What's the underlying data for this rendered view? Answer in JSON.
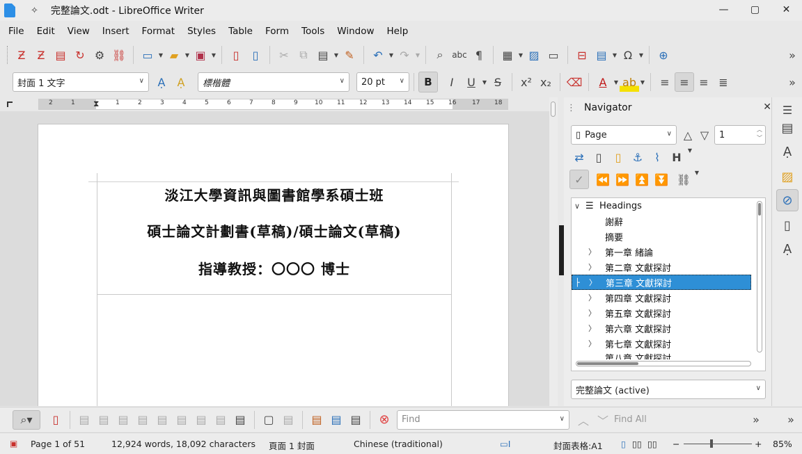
{
  "window": {
    "title": "完整論文.odt - LibreOffice Writer",
    "pin_icon": "pin-icon",
    "minimize": "—",
    "maximize": "▢",
    "close": "✕"
  },
  "menu": [
    "File",
    "Edit",
    "View",
    "Insert",
    "Format",
    "Styles",
    "Table",
    "Form",
    "Tools",
    "Window",
    "Help"
  ],
  "formatting": {
    "paragraph_style": "封面 1 文字",
    "font_name": "標楷體",
    "font_size": "20 pt"
  },
  "ruler": {
    "labels": [
      "2",
      "1",
      "1",
      "2",
      "3",
      "4",
      "5",
      "6",
      "7",
      "8",
      "9",
      "10",
      "11",
      "12",
      "13",
      "14",
      "15",
      "16",
      "17",
      "18"
    ]
  },
  "document": {
    "line1": "淡江大學資訊與圖書館學系碩士班",
    "line2": "碩士論文計劃書(草稿)/碩士論文(草稿)",
    "line3": "指導教授：〇〇〇  博士"
  },
  "navigator": {
    "title": "Navigator",
    "navigate_by": "Page",
    "page_number": "1",
    "headings_label": "Headings",
    "headings": [
      {
        "label": "謝辭",
        "expandable": false,
        "selected": false
      },
      {
        "label": "摘要",
        "expandable": false,
        "selected": false
      },
      {
        "label": "第一章 緒論",
        "expandable": true,
        "selected": false
      },
      {
        "label": "第二章 文獻探討",
        "expandable": true,
        "selected": false
      },
      {
        "label": "第三章 文獻探討",
        "expandable": true,
        "selected": true
      },
      {
        "label": "第四章 文獻探討",
        "expandable": true,
        "selected": false
      },
      {
        "label": "第五章 文獻探討",
        "expandable": true,
        "selected": false
      },
      {
        "label": "第六章 文獻探討",
        "expandable": true,
        "selected": false
      },
      {
        "label": "第七章 文獻探討",
        "expandable": true,
        "selected": false
      },
      {
        "label": "第八章 文獻探討",
        "expandable": true,
        "selected": false
      }
    ],
    "document_select": "完整論文 (active)"
  },
  "find": {
    "placeholder": "Find",
    "find_all": "Find All"
  },
  "status": {
    "page": "Page 1 of 51",
    "words": "12,924 words, 18,092 characters",
    "page_style": "頁面 1 封面",
    "language": "Chinese (traditional)",
    "table_cell": "封面表格:A1",
    "zoom": "85%"
  }
}
